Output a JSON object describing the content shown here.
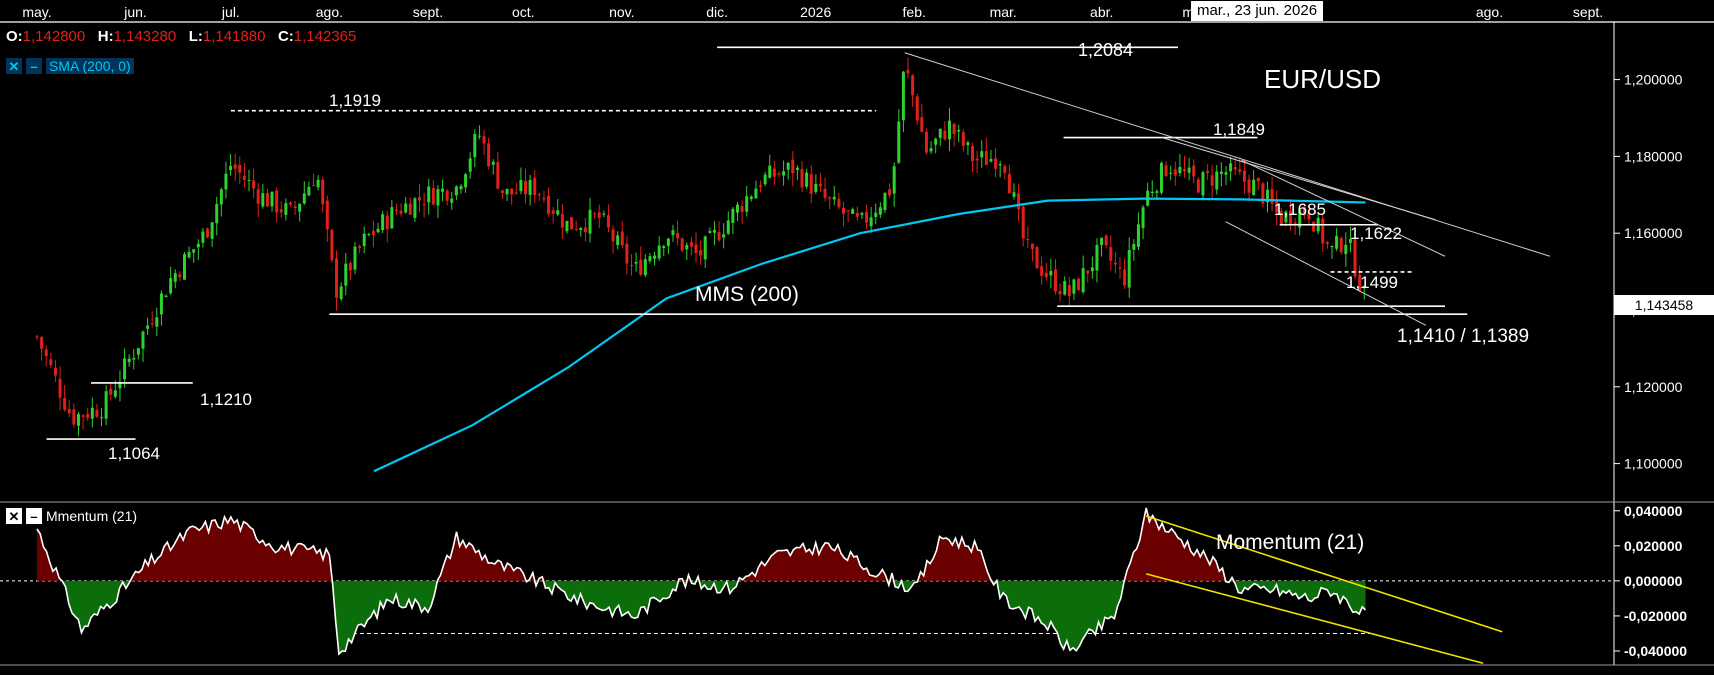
{
  "months": [
    "may.",
    "jun.",
    "jul.",
    "ago.",
    "sept.",
    "oct.",
    "nov.",
    "dic.",
    "2026",
    "feb.",
    "mar.",
    "abr.",
    "may.",
    "mar., 23 jun. 2026",
    "ago.",
    "sept."
  ],
  "ohlc": {
    "open_label": "O:",
    "open": "1,142800",
    "high_label": "H:",
    "high": "1,143280",
    "low_label": "L:",
    "low": "1,141880",
    "close_label": "C:",
    "close": "1,142365"
  },
  "sma_legend": {
    "close_icon": "close-icon",
    "collapse_icon": "minus-icon",
    "label": "SMA (200, 0)"
  },
  "momentum_legend": {
    "close_icon": "close-icon",
    "collapse_icon": "minus-icon",
    "label": "Mmentum (21)"
  },
  "cursor_date": "mar., 23 jun. 2026",
  "last_price": "1,143458",
  "colors": {
    "up": "#2fd12f",
    "down": "#e0201a",
    "sma": "#00c8f0",
    "trend": "#ffffff",
    "momentum_channel": "#f2e100",
    "mom_pos": "#6b0000",
    "mom_neg": "#0b6e0b"
  },
  "chart_data": [
    {
      "type": "candlestick",
      "title": "EUR/USD",
      "ylim": [
        1.09,
        1.215
      ],
      "y_ticks": [
        "1,200000",
        "1,180000",
        "1,160000",
        "1,140000",
        "1,120000",
        "1,100000"
      ],
      "x_ticks": [
        "may.",
        "jun.",
        "jul.",
        "ago.",
        "sept.",
        "oct.",
        "nov.",
        "dic.",
        "2026",
        "feb.",
        "mar.",
        "abr.",
        "may.",
        "ago.",
        "sept."
      ],
      "close_path": [
        [
          "2025-05-01",
          1.133
        ],
        [
          "2025-05-12",
          1.112
        ],
        [
          "2025-05-22",
          1.115
        ],
        [
          "2025-06-01",
          1.13
        ],
        [
          "2025-06-12",
          1.148
        ],
        [
          "2025-06-23",
          1.16
        ],
        [
          "2025-07-01",
          1.178
        ],
        [
          "2025-07-10",
          1.17
        ],
        [
          "2025-07-20",
          1.165
        ],
        [
          "2025-07-28",
          1.176
        ],
        [
          "2025-08-03",
          1.145
        ],
        [
          "2025-08-12",
          1.158
        ],
        [
          "2025-08-22",
          1.166
        ],
        [
          "2025-09-01",
          1.17
        ],
        [
          "2025-09-10",
          1.172
        ],
        [
          "2025-09-17",
          1.186
        ],
        [
          "2025-09-25",
          1.17
        ],
        [
          "2025-10-05",
          1.172
        ],
        [
          "2025-10-15",
          1.162
        ],
        [
          "2025-10-25",
          1.164
        ],
        [
          "2025-11-05",
          1.15
        ],
        [
          "2025-11-15",
          1.16
        ],
        [
          "2025-11-25",
          1.154
        ],
        [
          "2025-12-05",
          1.164
        ],
        [
          "2025-12-15",
          1.174
        ],
        [
          "2025-12-25",
          1.177
        ],
        [
          "2026-01-05",
          1.168
        ],
        [
          "2026-01-15",
          1.162
        ],
        [
          "2026-01-25",
          1.172
        ],
        [
          "2026-01-29",
          1.204
        ],
        [
          "2026-02-05",
          1.181
        ],
        [
          "2026-02-12",
          1.188
        ],
        [
          "2026-02-20",
          1.179
        ],
        [
          "2026-03-01",
          1.18
        ],
        [
          "2026-03-08",
          1.156
        ],
        [
          "2026-03-15",
          1.149
        ],
        [
          "2026-03-22",
          1.144
        ],
        [
          "2026-04-01",
          1.156
        ],
        [
          "2026-04-08",
          1.148
        ],
        [
          "2026-04-15",
          1.17
        ],
        [
          "2026-04-22",
          1.178
        ],
        [
          "2026-05-01",
          1.173
        ],
        [
          "2026-05-10",
          1.176
        ],
        [
          "2026-05-20",
          1.172
        ],
        [
          "2026-05-27",
          1.164
        ],
        [
          "2026-06-05",
          1.166
        ],
        [
          "2026-06-12",
          1.155
        ],
        [
          "2026-06-17",
          1.159
        ],
        [
          "2026-06-23",
          1.1424
        ]
      ],
      "series": [
        {
          "name": "SMA (200, 0)",
          "values": [
            [
              "2025-08-15",
              1.098
            ],
            [
              "2025-09-15",
              1.11
            ],
            [
              "2025-10-15",
              1.125
            ],
            [
              "2025-11-15",
              1.143
            ],
            [
              "2025-12-15",
              1.152
            ],
            [
              "2026-01-15",
              1.16
            ],
            [
              "2026-02-15",
              1.165
            ],
            [
              "2026-03-15",
              1.1685
            ],
            [
              "2026-04-15",
              1.169
            ],
            [
              "2026-05-15",
              1.1688
            ],
            [
              "2026-06-23",
              1.168
            ]
          ]
        }
      ],
      "annotations": [
        {
          "label": "1,2084",
          "value": 1.2084
        },
        {
          "label": "1,1919",
          "value": 1.1919
        },
        {
          "label": "1,1849",
          "value": 1.1849
        },
        {
          "label": "1,1685",
          "value": 1.1685
        },
        {
          "label": "1,1622",
          "value": 1.1622
        },
        {
          "label": "1,1499",
          "value": 1.1499
        },
        {
          "label": "1,1410 / 1,1389",
          "value": 1.1389
        },
        {
          "label": "1,1210",
          "value": 1.121
        },
        {
          "label": "1,1064",
          "value": 1.1064
        },
        {
          "label": "MMS (200)"
        }
      ]
    },
    {
      "type": "area",
      "title": "Momentum (21)",
      "ylim": [
        -0.048,
        0.045
      ],
      "y_ticks": [
        "0,040000",
        "0,020000",
        "0,000000",
        "-0,020000",
        "-0,040000"
      ],
      "values": [
        [
          "2025-05-01",
          0.03
        ],
        [
          "2025-05-15",
          -0.028
        ],
        [
          "2025-05-25",
          -0.01
        ],
        [
          "2025-06-05",
          0.01
        ],
        [
          "2025-06-18",
          0.028
        ],
        [
          "2025-07-01",
          0.035
        ],
        [
          "2025-07-15",
          0.02
        ],
        [
          "2025-08-01",
          0.015
        ],
        [
          "2025-08-04",
          -0.04
        ],
        [
          "2025-08-20",
          -0.01
        ],
        [
          "2025-09-01",
          -0.015
        ],
        [
          "2025-09-10",
          0.025
        ],
        [
          "2025-09-22",
          0.01
        ],
        [
          "2025-10-05",
          0.0
        ],
        [
          "2025-10-20",
          -0.012
        ],
        [
          "2025-11-05",
          -0.02
        ],
        [
          "2025-11-20",
          0.0
        ],
        [
          "2025-12-05",
          -0.004
        ],
        [
          "2025-12-20",
          0.015
        ],
        [
          "2026-01-05",
          0.02
        ],
        [
          "2026-01-20",
          0.005
        ],
        [
          "2026-02-01",
          -0.005
        ],
        [
          "2026-02-10",
          0.025
        ],
        [
          "2026-02-20",
          0.02
        ],
        [
          "2026-03-01",
          -0.01
        ],
        [
          "2026-03-15",
          -0.025
        ],
        [
          "2026-03-22",
          -0.04
        ],
        [
          "2026-04-05",
          -0.02
        ],
        [
          "2026-04-15",
          0.038
        ],
        [
          "2026-04-25",
          0.025
        ],
        [
          "2026-05-05",
          0.012
        ],
        [
          "2026-05-15",
          -0.005
        ],
        [
          "2026-05-25",
          -0.005
        ],
        [
          "2026-06-05",
          -0.01
        ],
        [
          "2026-06-12",
          -0.005
        ],
        [
          "2026-06-23",
          -0.02
        ]
      ]
    }
  ]
}
